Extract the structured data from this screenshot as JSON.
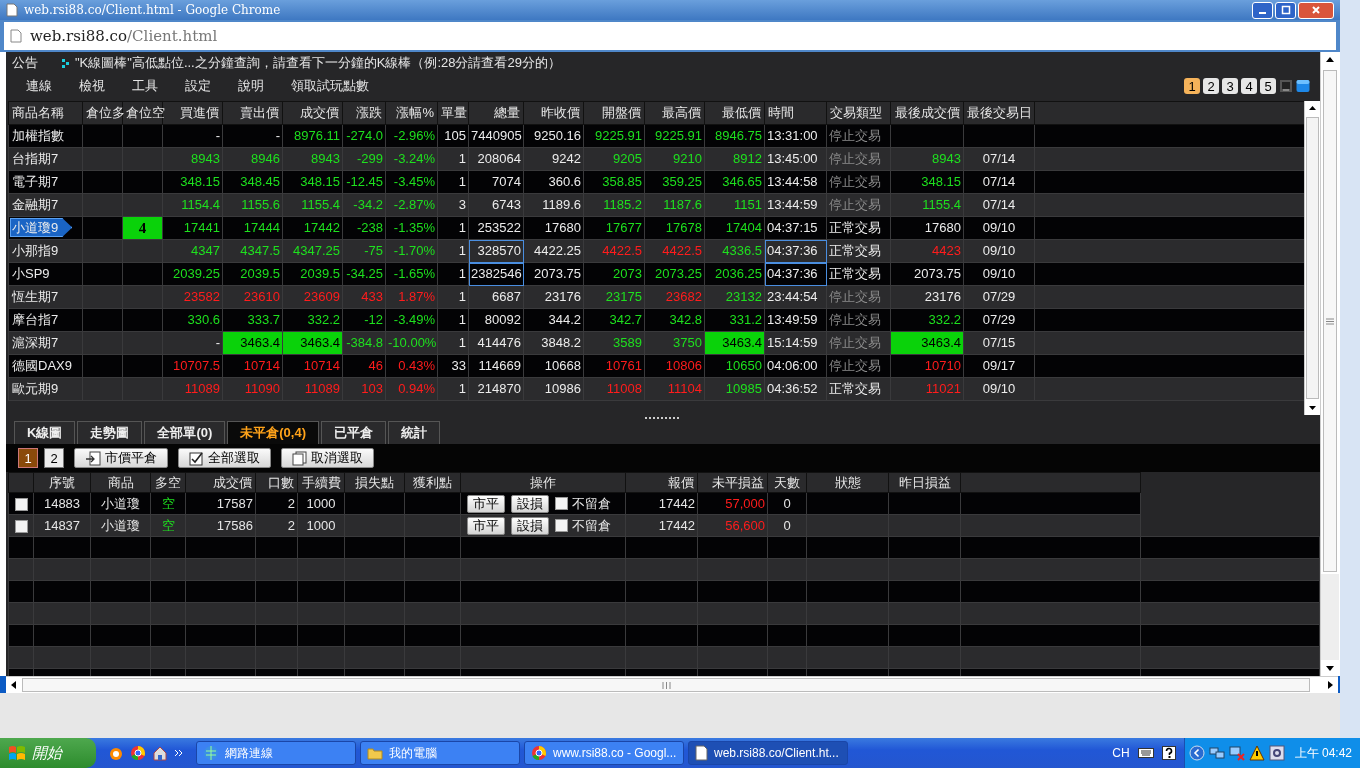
{
  "window": {
    "title": "web.rsi88.co/Client.html - Google Chrome"
  },
  "address_bar": {
    "host": "web.rsi88.co",
    "path": "/Client.html"
  },
  "announcement": {
    "label": "公告",
    "text": "\"K線圖棒\"高低點位...之分鐘查詢，請查看下一分鐘的K線棒（例:28分請查看29分的）"
  },
  "menu": [
    "連線",
    "檢視",
    "工具",
    "設定",
    "說明",
    "領取試玩點數"
  ],
  "layout_buttons": [
    {
      "label": "1",
      "selected": true
    },
    {
      "label": "2",
      "selected": false
    },
    {
      "label": "3",
      "selected": false
    },
    {
      "label": "4",
      "selected": false
    },
    {
      "label": "5",
      "selected": false
    }
  ],
  "quotes": {
    "columns": [
      "商品名稱",
      "倉位多",
      "倉位空",
      "買進價",
      "賣出價",
      "成交價",
      "漲跌",
      "漲幅%",
      "單量",
      "總量",
      "昨收價",
      "開盤價",
      "最高價",
      "最低價",
      "時間",
      "交易類型",
      "最後成交價",
      "最後交易日"
    ],
    "rows": [
      {
        "selected": false,
        "cells": [
          {
            "text": "加權指數",
            "kind": "plain"
          },
          "",
          "",
          {
            "text": "-",
            "kind": "plain"
          },
          {
            "text": "-",
            "kind": "plain"
          },
          {
            "text": "8976.11",
            "kind": "rise"
          },
          {
            "text": "-274.0",
            "kind": "rise"
          },
          {
            "text": "-2.96%",
            "kind": "rise"
          },
          {
            "text": "105",
            "kind": "plain"
          },
          {
            "text": "7440905",
            "kind": "plain"
          },
          {
            "text": "9250.16",
            "kind": "plain"
          },
          {
            "text": "9225.91",
            "kind": "rise"
          },
          {
            "text": "9225.91",
            "kind": "rise"
          },
          {
            "text": "8946.75",
            "kind": "rise"
          },
          {
            "text": "13:31:00",
            "kind": "plain"
          },
          {
            "text": "停止交易",
            "kind": "muted"
          },
          "",
          ""
        ]
      },
      {
        "selected": false,
        "cells": [
          {
            "text": "台指期7",
            "kind": "plain"
          },
          "",
          "",
          {
            "text": "8943",
            "kind": "rise"
          },
          {
            "text": "8946",
            "kind": "rise"
          },
          {
            "text": "8943",
            "kind": "rise"
          },
          {
            "text": "-299",
            "kind": "rise"
          },
          {
            "text": "-3.24%",
            "kind": "rise"
          },
          {
            "text": "1",
            "kind": "plain"
          },
          {
            "text": "208064",
            "kind": "plain"
          },
          {
            "text": "9242",
            "kind": "plain"
          },
          {
            "text": "9205",
            "kind": "rise"
          },
          {
            "text": "9210",
            "kind": "rise"
          },
          {
            "text": "8912",
            "kind": "rise"
          },
          {
            "text": "13:45:00",
            "kind": "plain"
          },
          {
            "text": "停止交易",
            "kind": "muted"
          },
          {
            "text": "8943",
            "kind": "rise"
          },
          {
            "text": "07/14",
            "kind": "plain"
          }
        ]
      },
      {
        "selected": false,
        "cells": [
          {
            "text": "電子期7",
            "kind": "plain"
          },
          "",
          "",
          {
            "text": "348.15",
            "kind": "rise"
          },
          {
            "text": "348.45",
            "kind": "rise"
          },
          {
            "text": "348.15",
            "kind": "rise"
          },
          {
            "text": "-12.45",
            "kind": "rise"
          },
          {
            "text": "-3.45%",
            "kind": "rise"
          },
          {
            "text": "1",
            "kind": "plain"
          },
          {
            "text": "7074",
            "kind": "plain"
          },
          {
            "text": "360.6",
            "kind": "plain"
          },
          {
            "text": "358.85",
            "kind": "rise"
          },
          {
            "text": "359.25",
            "kind": "rise"
          },
          {
            "text": "346.65",
            "kind": "rise"
          },
          {
            "text": "13:44:58",
            "kind": "plain"
          },
          {
            "text": "停止交易",
            "kind": "muted"
          },
          {
            "text": "348.15",
            "kind": "rise"
          },
          {
            "text": "07/14",
            "kind": "plain"
          }
        ]
      },
      {
        "selected": false,
        "cells": [
          {
            "text": "金融期7",
            "kind": "plain"
          },
          "",
          "",
          {
            "text": "1154.4",
            "kind": "rise"
          },
          {
            "text": "1155.6",
            "kind": "rise"
          },
          {
            "text": "1155.4",
            "kind": "rise"
          },
          {
            "text": "-34.2",
            "kind": "rise"
          },
          {
            "text": "-2.87%",
            "kind": "rise"
          },
          {
            "text": "3",
            "kind": "plain"
          },
          {
            "text": "6743",
            "kind": "plain"
          },
          {
            "text": "1189.6",
            "kind": "plain"
          },
          {
            "text": "1185.2",
            "kind": "rise"
          },
          {
            "text": "1187.6",
            "kind": "rise"
          },
          {
            "text": "1151",
            "kind": "rise"
          },
          {
            "text": "13:44:59",
            "kind": "plain"
          },
          {
            "text": "停止交易",
            "kind": "muted"
          },
          {
            "text": "1155.4",
            "kind": "rise"
          },
          {
            "text": "07/14",
            "kind": "plain"
          }
        ]
      },
      {
        "selected": true,
        "cells": [
          {
            "text": "小道瓊9",
            "kind": "plain"
          },
          "",
          {
            "text": "4",
            "kind": "flash"
          },
          {
            "text": "17441",
            "kind": "rise"
          },
          {
            "text": "17444",
            "kind": "rise"
          },
          {
            "text": "17442",
            "kind": "rise"
          },
          {
            "text": "-238",
            "kind": "rise"
          },
          {
            "text": "-1.35%",
            "kind": "rise"
          },
          {
            "text": "1",
            "kind": "plain"
          },
          {
            "text": "253522",
            "kind": "plain"
          },
          {
            "text": "17680",
            "kind": "plain"
          },
          {
            "text": "17677",
            "kind": "rise"
          },
          {
            "text": "17678",
            "kind": "rise"
          },
          {
            "text": "17404",
            "kind": "rise"
          },
          {
            "text": "04:37:15",
            "kind": "plain"
          },
          {
            "text": "正常交易",
            "kind": "plain"
          },
          {
            "text": "17680",
            "kind": "plain"
          },
          {
            "text": "09/10",
            "kind": "plain"
          }
        ]
      },
      {
        "selected": false,
        "cells": [
          {
            "text": "小那指9",
            "kind": "plain"
          },
          "",
          "",
          {
            "text": "4347",
            "kind": "rise"
          },
          {
            "text": "4347.5",
            "kind": "rise"
          },
          {
            "text": "4347.25",
            "kind": "rise"
          },
          {
            "text": "-75",
            "kind": "rise"
          },
          {
            "text": "-1.70%",
            "kind": "rise"
          },
          {
            "text": "1",
            "kind": "plain"
          },
          {
            "text": "328570",
            "kind": "outlined"
          },
          {
            "text": "4422.25",
            "kind": "plain"
          },
          {
            "text": "4422.5",
            "kind": "fall"
          },
          {
            "text": "4422.5",
            "kind": "fall"
          },
          {
            "text": "4336.5",
            "kind": "rise"
          },
          {
            "text": "04:37:36",
            "kind": "outlined"
          },
          {
            "text": "正常交易",
            "kind": "plain"
          },
          {
            "text": "4423",
            "kind": "fall"
          },
          {
            "text": "09/10",
            "kind": "plain"
          }
        ]
      },
      {
        "selected": false,
        "cells": [
          {
            "text": "小SP9",
            "kind": "plain"
          },
          "",
          "",
          {
            "text": "2039.25",
            "kind": "rise"
          },
          {
            "text": "2039.5",
            "kind": "rise"
          },
          {
            "text": "2039.5",
            "kind": "rise"
          },
          {
            "text": "-34.25",
            "kind": "rise"
          },
          {
            "text": "-1.65%",
            "kind": "rise"
          },
          {
            "text": "1",
            "kind": "plain"
          },
          {
            "text": "2382546",
            "kind": "outlined"
          },
          {
            "text": "2073.75",
            "kind": "plain"
          },
          {
            "text": "2073",
            "kind": "rise"
          },
          {
            "text": "2073.25",
            "kind": "rise"
          },
          {
            "text": "2036.25",
            "kind": "rise"
          },
          {
            "text": "04:37:36",
            "kind": "outlined"
          },
          {
            "text": "正常交易",
            "kind": "plain"
          },
          {
            "text": "2073.75",
            "kind": "plain"
          },
          {
            "text": "09/10",
            "kind": "plain"
          }
        ]
      },
      {
        "selected": false,
        "cells": [
          {
            "text": "恆生期7",
            "kind": "plain"
          },
          "",
          "",
          {
            "text": "23582",
            "kind": "fall"
          },
          {
            "text": "23610",
            "kind": "fall"
          },
          {
            "text": "23609",
            "kind": "fall"
          },
          {
            "text": "433",
            "kind": "fall"
          },
          {
            "text": "1.87%",
            "kind": "fall"
          },
          {
            "text": "1",
            "kind": "plain"
          },
          {
            "text": "6687",
            "kind": "plain"
          },
          {
            "text": "23176",
            "kind": "plain"
          },
          {
            "text": "23175",
            "kind": "rise"
          },
          {
            "text": "23682",
            "kind": "fall"
          },
          {
            "text": "23132",
            "kind": "rise"
          },
          {
            "text": "23:44:54",
            "kind": "plain"
          },
          {
            "text": "停止交易",
            "kind": "muted"
          },
          {
            "text": "23176",
            "kind": "plain"
          },
          {
            "text": "07/29",
            "kind": "plain"
          }
        ]
      },
      {
        "selected": false,
        "cells": [
          {
            "text": "摩台指7",
            "kind": "plain"
          },
          "",
          "",
          {
            "text": "330.6",
            "kind": "rise"
          },
          {
            "text": "333.7",
            "kind": "rise"
          },
          {
            "text": "332.2",
            "kind": "rise"
          },
          {
            "text": "-12",
            "kind": "rise"
          },
          {
            "text": "-3.49%",
            "kind": "rise"
          },
          {
            "text": "1",
            "kind": "plain"
          },
          {
            "text": "80092",
            "kind": "plain"
          },
          {
            "text": "344.2",
            "kind": "plain"
          },
          {
            "text": "342.7",
            "kind": "rise"
          },
          {
            "text": "342.8",
            "kind": "rise"
          },
          {
            "text": "331.2",
            "kind": "rise"
          },
          {
            "text": "13:49:59",
            "kind": "plain"
          },
          {
            "text": "停止交易",
            "kind": "muted"
          },
          {
            "text": "332.2",
            "kind": "rise"
          },
          {
            "text": "07/29",
            "kind": "plain"
          }
        ]
      },
      {
        "selected": false,
        "cells": [
          {
            "text": "滬深期7",
            "kind": "plain"
          },
          "",
          "",
          {
            "text": "-",
            "kind": "plain"
          },
          {
            "text": "3463.4",
            "kind": "flash"
          },
          {
            "text": "3463.4",
            "kind": "flash"
          },
          {
            "text": "-384.8",
            "kind": "rise"
          },
          {
            "text": "-10.00%",
            "kind": "rise"
          },
          {
            "text": "1",
            "kind": "plain"
          },
          {
            "text": "414476",
            "kind": "plain"
          },
          {
            "text": "3848.2",
            "kind": "plain"
          },
          {
            "text": "3589",
            "kind": "rise"
          },
          {
            "text": "3750",
            "kind": "rise"
          },
          {
            "text": "3463.4",
            "kind": "flash"
          },
          {
            "text": "15:14:59",
            "kind": "plain"
          },
          {
            "text": "停止交易",
            "kind": "muted"
          },
          {
            "text": "3463.4",
            "kind": "flash"
          },
          {
            "text": "07/15",
            "kind": "plain"
          }
        ]
      },
      {
        "selected": false,
        "cells": [
          {
            "text": "德國DAX9",
            "kind": "plain"
          },
          "",
          "",
          {
            "text": "10707.5",
            "kind": "fall"
          },
          {
            "text": "10714",
            "kind": "fall"
          },
          {
            "text": "10714",
            "kind": "fall"
          },
          {
            "text": "46",
            "kind": "fall"
          },
          {
            "text": "0.43%",
            "kind": "fall"
          },
          {
            "text": "33",
            "kind": "plain"
          },
          {
            "text": "114669",
            "kind": "plain"
          },
          {
            "text": "10668",
            "kind": "plain"
          },
          {
            "text": "10761",
            "kind": "fall"
          },
          {
            "text": "10806",
            "kind": "fall"
          },
          {
            "text": "10650",
            "kind": "rise"
          },
          {
            "text": "04:06:00",
            "kind": "plain"
          },
          {
            "text": "停止交易",
            "kind": "muted"
          },
          {
            "text": "10710",
            "kind": "fall"
          },
          {
            "text": "09/17",
            "kind": "plain"
          }
        ]
      },
      {
        "selected": false,
        "cells": [
          {
            "text": "歐元期9",
            "kind": "plain"
          },
          "",
          "",
          {
            "text": "11089",
            "kind": "fall"
          },
          {
            "text": "11090",
            "kind": "fall"
          },
          {
            "text": "11089",
            "kind": "fall"
          },
          {
            "text": "103",
            "kind": "fall"
          },
          {
            "text": "0.94%",
            "kind": "fall"
          },
          {
            "text": "1",
            "kind": "plain"
          },
          {
            "text": "214870",
            "kind": "plain"
          },
          {
            "text": "10986",
            "kind": "plain"
          },
          {
            "text": "11008",
            "kind": "fall"
          },
          {
            "text": "11104",
            "kind": "fall"
          },
          {
            "text": "10985",
            "kind": "rise"
          },
          {
            "text": "04:36:52",
            "kind": "plain"
          },
          {
            "text": "正常交易",
            "kind": "plain"
          },
          {
            "text": "11021",
            "kind": "fall"
          },
          {
            "text": "09/10",
            "kind": "plain"
          }
        ]
      }
    ]
  },
  "bottom_tabs": [
    {
      "label": "K線圖",
      "selected": false
    },
    {
      "label": "走勢圖",
      "selected": false
    },
    {
      "label": "全部單(0)",
      "selected": false
    },
    {
      "label": "未平倉(0,4)",
      "selected": true
    },
    {
      "label": "已平倉",
      "selected": false
    },
    {
      "label": "統計",
      "selected": false
    }
  ],
  "pages": [
    {
      "label": "1",
      "selected": true
    },
    {
      "label": "2",
      "selected": false
    }
  ],
  "actions": [
    {
      "label": "市價平倉",
      "kind": "close"
    },
    {
      "label": "全部選取",
      "kind": "select"
    },
    {
      "label": "取消選取",
      "kind": "clear"
    }
  ],
  "positions": {
    "columns": [
      "序號",
      "商品",
      "多空",
      "成交價",
      "口數",
      "手續費",
      "損失點",
      "獲利點",
      "操作",
      "報價",
      "未平損益",
      "天數",
      "狀態",
      "昨日損益"
    ],
    "rows": [
      {
        "checked": false,
        "id": "14883",
        "product": "小道瓊",
        "side": "空",
        "price": "17587",
        "lots": "2",
        "fee": "1000",
        "close_button": "市平",
        "stop_button": "設損",
        "no_overnight": {
          "label": "不留倉",
          "checked": false
        },
        "quote": "17442",
        "pnl": "57,000",
        "days": "0"
      },
      {
        "checked": false,
        "id": "14837",
        "product": "小道瓊",
        "side": "空",
        "price": "17586",
        "lots": "2",
        "fee": "1000",
        "close_button": "市平",
        "stop_button": "設損",
        "no_overnight": {
          "label": "不留倉",
          "checked": false
        },
        "quote": "17442",
        "pnl": "56,600",
        "days": "0"
      }
    ]
  },
  "taskbar": {
    "start": "開始",
    "tasks": [
      {
        "label": "網路連線",
        "kind": "network",
        "selected": false
      },
      {
        "label": "我的電腦",
        "kind": "folder",
        "selected": false
      },
      {
        "label": "www.rsi88.co - Googl...",
        "kind": "browser",
        "selected": false
      },
      {
        "label": "web.rsi88.co/Client.ht...",
        "kind": "page",
        "selected": true
      }
    ],
    "language": "CH",
    "clock": "上午 04:42"
  }
}
